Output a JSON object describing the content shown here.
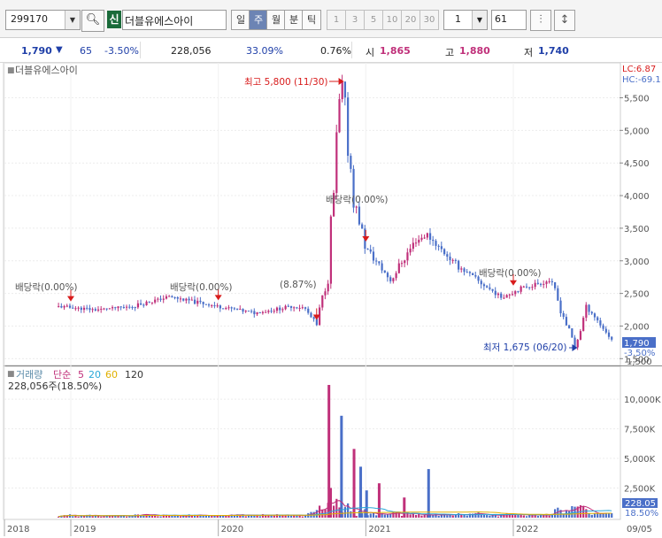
{
  "toolbar": {
    "code": "299170",
    "name_badge": "신",
    "name": "더블유에스아이",
    "period_buttons": [
      "일",
      "주",
      "월",
      "분",
      "틱"
    ],
    "active_period": "주",
    "minute_buttons": [
      "1",
      "3",
      "5",
      "10",
      "20",
      "30"
    ],
    "count": "1",
    "range": "61"
  },
  "quote": {
    "price": "1,790",
    "change": "65",
    "change_pct": "-3.50%",
    "volume": "228,056",
    "volume_ratio": "33.09%",
    "turnover": "0.76%",
    "open_label": "시",
    "open": "1,865",
    "high_label": "고",
    "high": "1,880",
    "low_label": "저",
    "low": "1,740"
  },
  "colors": {
    "up": "#c0307a",
    "down": "#4a6fc8",
    "accent_red": "#d81b1b",
    "accent_blue": "#1f3fa8"
  },
  "chart_data": [
    {
      "type": "candlestick",
      "title": "더블유에스아이",
      "indicators": [
        "LC:6.87",
        "HC:-69.1"
      ],
      "x_ticks": [
        "2018",
        "2019",
        "2020",
        "2021",
        "2022",
        "09/05"
      ],
      "y_ticks": [
        1500,
        2000,
        2500,
        3000,
        3500,
        4000,
        4500,
        5000,
        5500
      ],
      "ylim": [
        1450,
        5900
      ],
      "price_path": [
        [
          "2018-12",
          2300
        ],
        [
          "2019-03",
          2250
        ],
        [
          "2019-06",
          2300
        ],
        [
          "2019-09",
          2450
        ],
        [
          "2020-01",
          2300
        ],
        [
          "2020-04",
          2200
        ],
        [
          "2020-07",
          2300
        ],
        [
          "2020-08",
          2280
        ],
        [
          "2020-09",
          2000
        ],
        [
          "2020-10",
          2900
        ],
        [
          "2020-11",
          5800
        ],
        [
          "2020-12",
          4000
        ],
        [
          "2021-01",
          3200
        ],
        [
          "2021-03",
          2700
        ],
        [
          "2021-05",
          3300
        ],
        [
          "2021-06",
          3400
        ],
        [
          "2021-08",
          3000
        ],
        [
          "2021-10",
          2700
        ],
        [
          "2021-12",
          2450
        ],
        [
          "2022-02",
          2600
        ],
        [
          "2022-04",
          2700
        ],
        [
          "2022-06",
          1675
        ],
        [
          "2022-07",
          2300
        ],
        [
          "2022-09",
          1790
        ]
      ],
      "annotations": [
        {
          "label": "배당락(0.00%)",
          "at": "2019-01"
        },
        {
          "label": "배당락(0.00%)",
          "at": "2020-01"
        },
        {
          "label": "(8.87%)",
          "at": "2020-09"
        },
        {
          "label": "배당락(0.00%)",
          "at": "2021-01"
        },
        {
          "label": "배당락(0.00%)",
          "at": "2022-01"
        }
      ],
      "high_mark": "최고 5,800 (11/30)",
      "low_mark": "최저 1,675 (06/20)",
      "last_price": "1,790",
      "last_change": "-3.50%",
      "floor_label": "1,500"
    },
    {
      "type": "bar",
      "title": "거래량",
      "ma_label": "단순",
      "ma_periods": [
        "5",
        "20",
        "60",
        "120"
      ],
      "ma_colors": [
        "#c0307a",
        "#29a8d8",
        "#e0b000",
        "#555555"
      ],
      "current": "228,056주(18.50%)",
      "y_ticks": [
        "10,000K",
        "7,500K",
        "5,000K",
        "2,500K"
      ],
      "y_values": [
        10000,
        7500,
        5000,
        2500
      ],
      "ylim": [
        0,
        11500
      ],
      "last_value": "228.05",
      "last_ratio": "18.50%",
      "spikes": [
        [
          "2020-10",
          11200
        ],
        [
          "2020-11",
          8600
        ],
        [
          "2020-12",
          5800
        ],
        [
          "2021-01",
          2300
        ],
        [
          "2021-02",
          2900
        ],
        [
          "2021-06",
          4100
        ],
        [
          "2021-04",
          1700
        ],
        [
          "2020-12b",
          4300
        ]
      ]
    }
  ]
}
